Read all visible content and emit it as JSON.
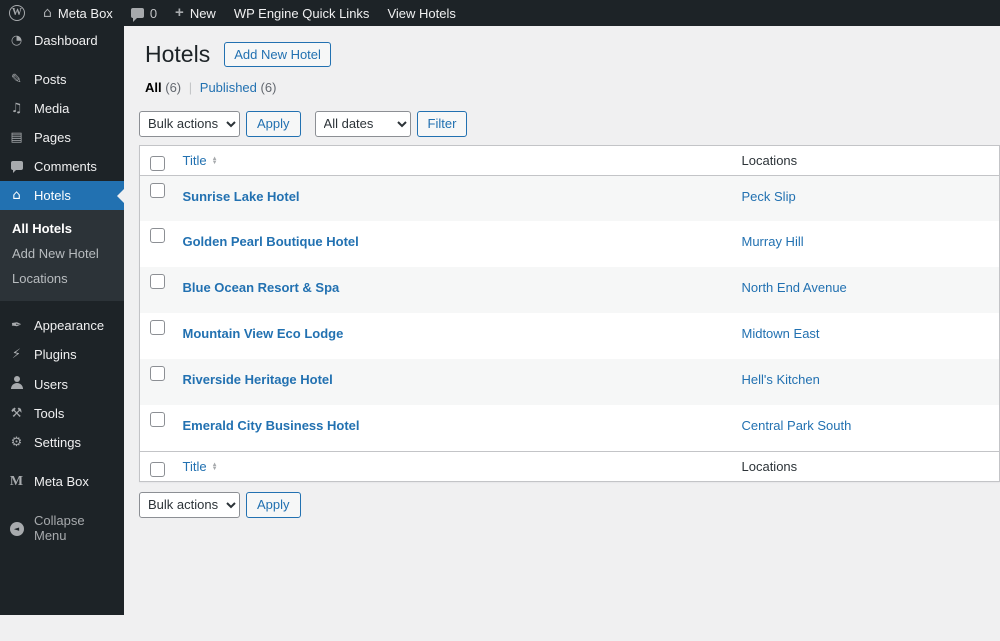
{
  "admin_bar": {
    "site_name": "Meta Box",
    "comment_count": "0",
    "new_label": "New",
    "wpengine_label": "WP Engine Quick Links",
    "view_hotels_label": "View Hotels",
    "wp_logo_letter": "W"
  },
  "sidebar": {
    "items": [
      {
        "label": "Dashboard",
        "icon": "dashboard-icon"
      },
      {
        "label": "Posts",
        "icon": "pin-icon"
      },
      {
        "label": "Media",
        "icon": "media-icon"
      },
      {
        "label": "Pages",
        "icon": "pages-icon"
      },
      {
        "label": "Comments",
        "icon": "comment-bubble-icon"
      },
      {
        "label": "Hotels",
        "icon": "house-icon"
      },
      {
        "label": "Appearance",
        "icon": "brush-icon"
      },
      {
        "label": "Plugins",
        "icon": "plugin-icon"
      },
      {
        "label": "Users",
        "icon": "person-icon"
      },
      {
        "label": "Tools",
        "icon": "tools-icon"
      },
      {
        "label": "Settings",
        "icon": "settings-icon"
      },
      {
        "label": "Meta Box",
        "icon": "metabox-m-icon"
      },
      {
        "label": "Collapse Menu",
        "icon": "collapse-arrow-icon"
      }
    ],
    "hotels_submenu": {
      "all_hotels": "All Hotels",
      "add_new_hotel": "Add New Hotel",
      "locations": "Locations"
    }
  },
  "page": {
    "title": "Hotels",
    "add_new_label": "Add New Hotel",
    "views": {
      "all_label": "All",
      "all_count": "(6)",
      "separator": "|",
      "published_label": "Published",
      "published_count": "(6)"
    },
    "tablenav": {
      "bulk_actions_label": "Bulk actions",
      "apply_label": "Apply",
      "all_dates_label": "All dates",
      "filter_label": "Filter"
    }
  },
  "table": {
    "columns": {
      "title": "Title",
      "locations": "Locations"
    },
    "rows": [
      {
        "title": "Sunrise Lake Hotel",
        "location": "Peck Slip"
      },
      {
        "title": "Golden Pearl Boutique Hotel",
        "location": "Murray Hill"
      },
      {
        "title": "Blue Ocean Resort & Spa",
        "location": "North End Avenue"
      },
      {
        "title": "Mountain View Eco Lodge",
        "location": "Midtown East"
      },
      {
        "title": "Riverside Heritage Hotel",
        "location": "Hell's Kitchen"
      },
      {
        "title": "Emerald City Business Hotel",
        "location": "Central Park South"
      }
    ]
  },
  "colors": {
    "admin_bar_bg": "#1d2327",
    "sidebar_bg": "#1d2327",
    "submenu_bg": "#2c3338",
    "active_menu_bg": "#2271b1",
    "link": "#2271b1",
    "content_bg": "#f0f0f1",
    "table_border": "#c3c4c7",
    "stripe_row_bg": "#f6f7f7"
  }
}
